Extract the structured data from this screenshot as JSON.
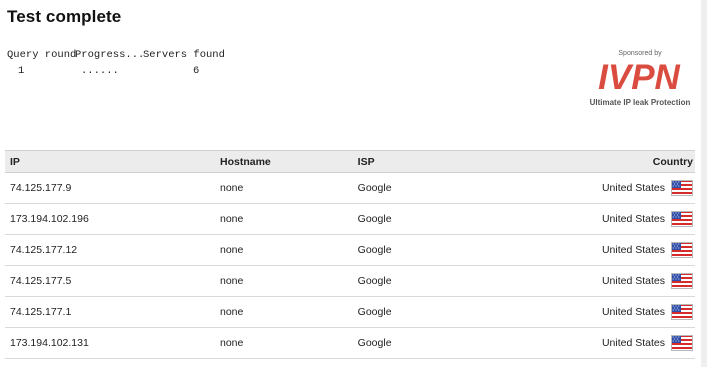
{
  "page": {
    "title": "Test complete"
  },
  "query_progress": {
    "headers": [
      "Query round",
      "Progress...",
      "Servers found"
    ],
    "row": {
      "round": "1",
      "progress": "......",
      "servers_found": "6"
    }
  },
  "sponsor": {
    "label": "Sponsored by",
    "logo_text": "IVPN",
    "tagline": "Ultimate IP leak Protection"
  },
  "table": {
    "headers": {
      "ip": "IP",
      "hostname": "Hostname",
      "isp": "ISP",
      "country": "Country"
    },
    "rows": [
      {
        "ip": "74.125.177.9",
        "hostname": "none",
        "isp": "Google",
        "country": "United States"
      },
      {
        "ip": "173.194.102.196",
        "hostname": "none",
        "isp": "Google",
        "country": "United States"
      },
      {
        "ip": "74.125.177.12",
        "hostname": "none",
        "isp": "Google",
        "country": "United States"
      },
      {
        "ip": "74.125.177.5",
        "hostname": "none",
        "isp": "Google",
        "country": "United States"
      },
      {
        "ip": "74.125.177.1",
        "hostname": "none",
        "isp": "Google",
        "country": "United States"
      },
      {
        "ip": "173.194.102.131",
        "hostname": "none",
        "isp": "Google",
        "country": "United States"
      }
    ]
  },
  "icons": {
    "flag": "us-flag-icon"
  },
  "colors": {
    "logo_red": "#d94c3f",
    "header_bg": "#ececec",
    "border": "#d9d9d9"
  }
}
